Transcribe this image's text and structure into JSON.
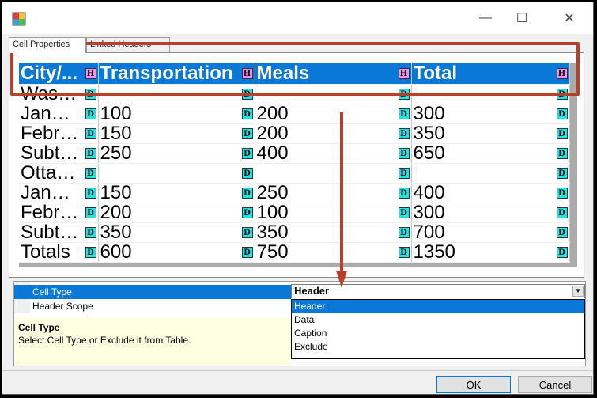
{
  "window": {
    "minimize_glyph": "—",
    "maximize_glyph": "☐",
    "close_glyph": "✕"
  },
  "tabs": [
    {
      "label": "Cell Properties",
      "active": true
    },
    {
      "label": "Linked Headers",
      "active": false
    }
  ],
  "grid": {
    "header": [
      {
        "text": "City/...",
        "badge": "H"
      },
      {
        "text": "Transportation",
        "badge": "H"
      },
      {
        "text": "Meals",
        "badge": "H"
      },
      {
        "text": "Total",
        "badge": "H"
      }
    ],
    "rows": [
      [
        "Washington",
        "",
        "",
        ""
      ],
      [
        "January",
        "100",
        "200",
        "300"
      ],
      [
        "February",
        "150",
        "200",
        "350"
      ],
      [
        "Subtotal",
        "250",
        "400",
        "650"
      ],
      [
        "Ottawa",
        "",
        "",
        ""
      ],
      [
        "January",
        "150",
        "250",
        "400"
      ],
      [
        "February",
        "200",
        "100",
        "300"
      ],
      [
        "Subtotal",
        "350",
        "350",
        "700"
      ],
      [
        "Totals",
        "600",
        "750",
        "1350"
      ]
    ],
    "data_badge": "D"
  },
  "properties": {
    "rows": [
      {
        "label": "Cell Type",
        "selected": true
      },
      {
        "label": "Header Scope",
        "selected": false
      }
    ],
    "description_title": "Cell Type",
    "description_text": "Select Cell Type or Exclude it from Table."
  },
  "cell_type_dropdown": {
    "value": "Header",
    "options": [
      {
        "label": "Header",
        "selected": true
      },
      {
        "label": "Data",
        "selected": false
      },
      {
        "label": "Caption",
        "selected": false
      },
      {
        "label": "Exclude",
        "selected": false
      }
    ]
  },
  "buttons": {
    "ok": "OK",
    "cancel": "Cancel"
  },
  "colors": {
    "accent": "#0a78d7",
    "header_badge": "#f58ff5",
    "data_badge": "#19e6e6",
    "annotation": "#b8402b"
  }
}
